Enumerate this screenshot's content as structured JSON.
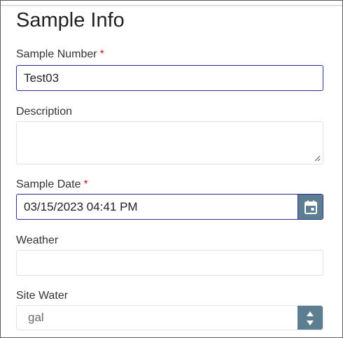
{
  "form": {
    "title": "Sample Info",
    "sample_number": {
      "label": "Sample Number",
      "required_mark": "*",
      "value": "Test03"
    },
    "description": {
      "label": "Description",
      "value": ""
    },
    "sample_date": {
      "label": "Sample Date",
      "required_mark": "*",
      "value": "03/15/2023 04:41 PM",
      "button_icon": "calendar-icon"
    },
    "weather": {
      "label": "Weather",
      "value": ""
    },
    "site_water": {
      "label": "Site Water",
      "value": "gal",
      "button_icon": "up-down-arrows-icon"
    }
  },
  "colors": {
    "accent_border": "#2a2f9a",
    "button_bg": "#5d7d90",
    "required": "#d11a1a"
  }
}
